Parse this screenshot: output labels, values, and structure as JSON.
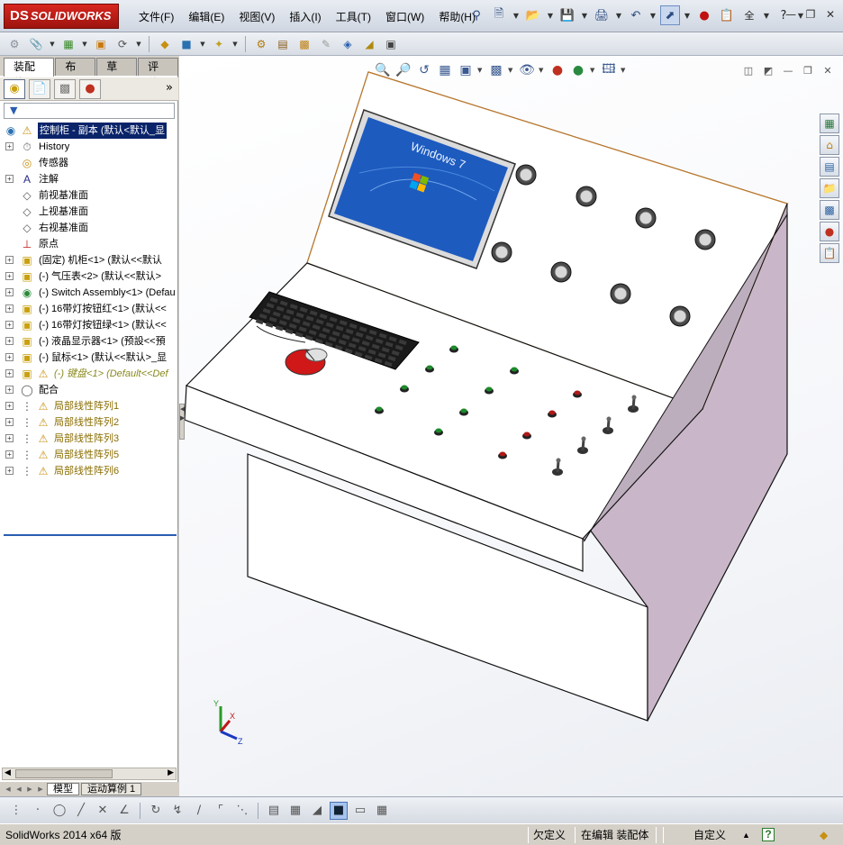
{
  "app": {
    "brand_prefix": "DS",
    "brand": "SOLIDWORKS",
    "menus": [
      "文件(F)",
      "编辑(E)",
      "视图(V)",
      "插入(I)",
      "工具(T)",
      "窗口(W)",
      "帮助(H)"
    ],
    "quick_icons": [
      "pin-icon",
      "new-document-icon",
      "open-folder-icon",
      "save-icon",
      "print-icon",
      "undo-icon",
      "select-arrow-icon",
      "rebuild-traffic-light-icon",
      "options-icon",
      "search-commands-label",
      "help-icon"
    ],
    "search_label": "全",
    "window_controls": [
      "minimize",
      "restore",
      "close"
    ]
  },
  "command_manager": {
    "tabs": [
      "装配体",
      "布局",
      "草图",
      "评估"
    ],
    "active_tab": 0
  },
  "feature_manager": {
    "tabs": [
      "feature-tree-icon",
      "property-manager-icon",
      "configuration-manager-icon",
      "appearance-manager-icon"
    ],
    "more": "»",
    "tree": [
      {
        "expander": "",
        "icon": "assembly-icon",
        "warn": true,
        "label": "控制柜 - 副本 (默认<默认_显",
        "style": "root"
      },
      {
        "expander": "+",
        "icon": "history-icon",
        "label": "History",
        "style": ""
      },
      {
        "expander": "",
        "icon": "sensor-icon",
        "label": "传感器",
        "style": ""
      },
      {
        "expander": "+",
        "icon": "annotation-icon",
        "label": "注解",
        "style": ""
      },
      {
        "expander": "",
        "icon": "plane-icon",
        "label": "前视基准面",
        "style": ""
      },
      {
        "expander": "",
        "icon": "plane-icon",
        "label": "上视基准面",
        "style": ""
      },
      {
        "expander": "",
        "icon": "plane-icon",
        "label": "右视基准面",
        "style": ""
      },
      {
        "expander": "",
        "icon": "origin-icon",
        "label": "原点",
        "style": ""
      },
      {
        "expander": "+",
        "icon": "part-icon",
        "label": "(固定) 机柜<1> (默认<<默认",
        "style": ""
      },
      {
        "expander": "+",
        "icon": "part-icon",
        "label": "(-) 气压表<2> (默认<<默认>",
        "style": ""
      },
      {
        "expander": "+",
        "icon": "subassembly-icon",
        "label": "(-) Switch Assembly<1> (Defau",
        "style": ""
      },
      {
        "expander": "+",
        "icon": "part-icon",
        "label": "(-) 16带灯按钮红<1> (默认<<",
        "style": ""
      },
      {
        "expander": "+",
        "icon": "part-icon",
        "label": "(-) 16带灯按钮绿<1> (默认<<",
        "style": ""
      },
      {
        "expander": "+",
        "icon": "part-icon",
        "label": "(-) 液晶显示器<1> (预設<<預",
        "style": ""
      },
      {
        "expander": "+",
        "icon": "part-icon",
        "label": "(-) 鼠标<1> (默认<<默认>_显",
        "style": ""
      },
      {
        "expander": "+",
        "icon": "part-icon",
        "warn": true,
        "label": "(-) 键盘<1> (Default<<Def",
        "style": "dim"
      },
      {
        "expander": "+",
        "icon": "mates-icon",
        "label": "配合",
        "style": ""
      },
      {
        "expander": "+",
        "icon": "pattern-icon",
        "warn": true,
        "label": "局部线性阵列1",
        "style": "warn"
      },
      {
        "expander": "+",
        "icon": "pattern-icon",
        "warn": true,
        "label": "局部线性阵列2",
        "style": "warn"
      },
      {
        "expander": "+",
        "icon": "pattern-icon",
        "warn": true,
        "label": "局部线性阵列3",
        "style": "warn"
      },
      {
        "expander": "+",
        "icon": "pattern-icon",
        "warn": true,
        "label": "局部线性阵列5",
        "style": "warn"
      },
      {
        "expander": "+",
        "icon": "pattern-icon",
        "warn": true,
        "label": "局部线性阵列6",
        "style": "warn"
      }
    ],
    "bottom_tabs": [
      "模型",
      "运动算例 1"
    ],
    "active_bottom_tab": 0
  },
  "viewport": {
    "monitor_text": "Windows 7",
    "triad_labels": {
      "x": "X",
      "y": "Y",
      "z": "Z"
    },
    "colors": {
      "panel_edge": "#c07a2a",
      "side_face": "#c8b8c8",
      "screen_blue": "#1e5bbf",
      "mouse_red": "#d01818",
      "button_green": "#1c8a2a",
      "button_red": "#b01818"
    }
  },
  "statusbar": {
    "app_version": "SolidWorks 2014 x64 版",
    "state": "欠定义",
    "mode": "在编辑 装配体",
    "units": "自定义",
    "help": "?"
  }
}
